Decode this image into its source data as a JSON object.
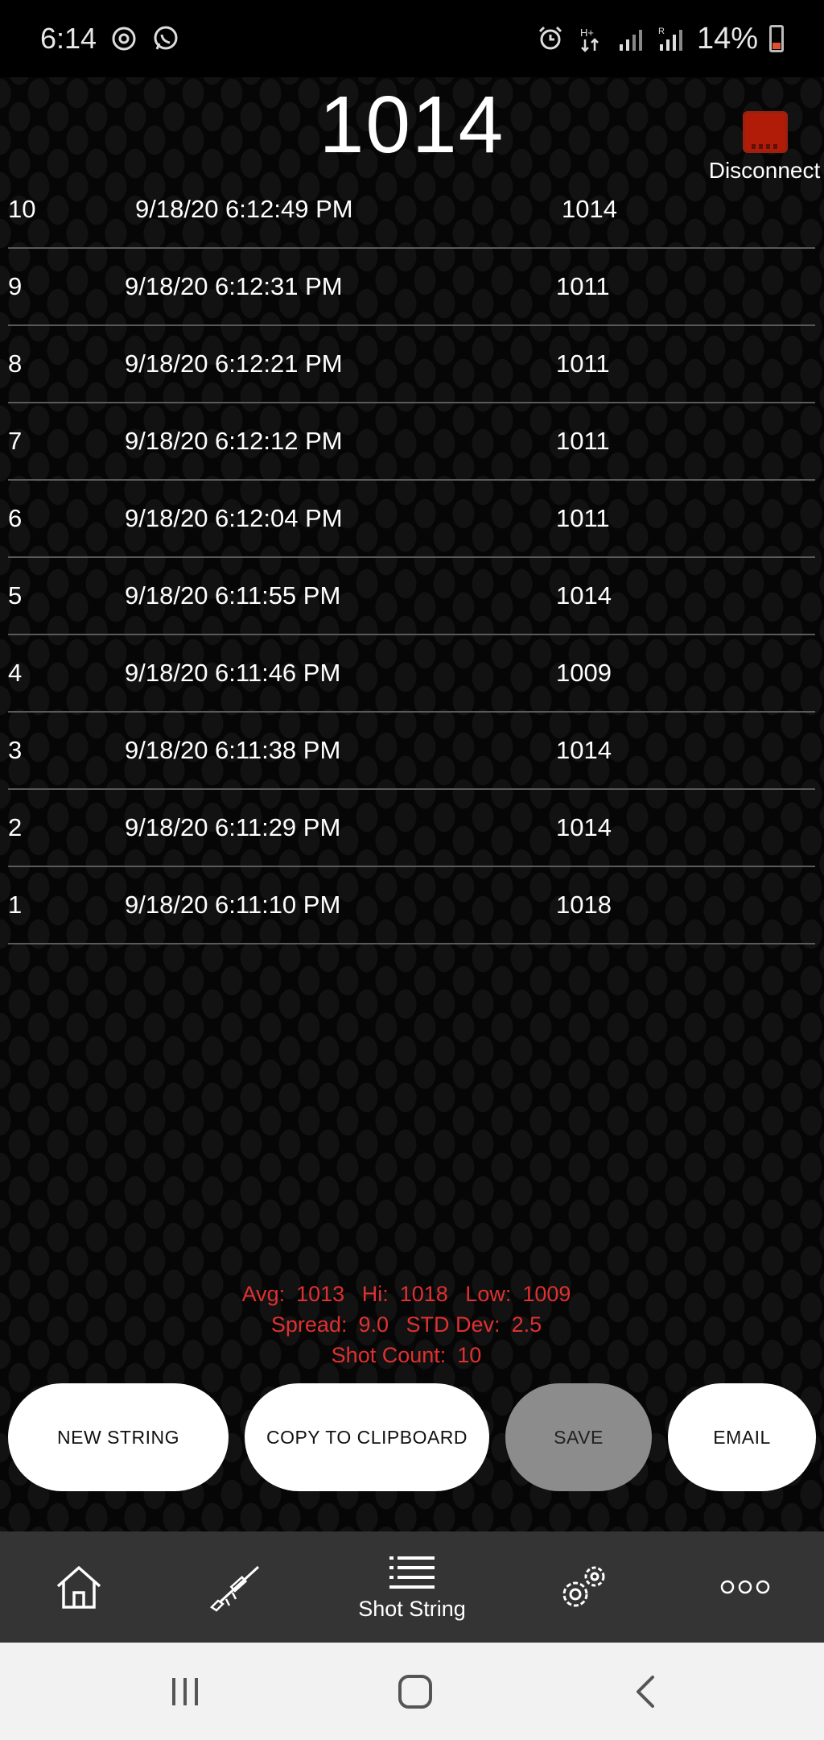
{
  "status_bar": {
    "time": "6:14",
    "battery_percent": "14%"
  },
  "header": {
    "current_reading": "1014",
    "disconnect_label": "Disconnect"
  },
  "shots": [
    {
      "num": "10",
      "time": "9/18/20 6:12:49 PM",
      "velocity": "1014"
    },
    {
      "num": "9",
      "time": "9/18/20 6:12:31 PM",
      "velocity": "1011"
    },
    {
      "num": "8",
      "time": "9/18/20 6:12:21 PM",
      "velocity": "1011"
    },
    {
      "num": "7",
      "time": "9/18/20 6:12:12 PM",
      "velocity": "1011"
    },
    {
      "num": "6",
      "time": "9/18/20 6:12:04 PM",
      "velocity": "1011"
    },
    {
      "num": "5",
      "time": "9/18/20 6:11:55 PM",
      "velocity": "1014"
    },
    {
      "num": "4",
      "time": "9/18/20 6:11:46 PM",
      "velocity": "1009"
    },
    {
      "num": "3",
      "time": "9/18/20 6:11:38 PM",
      "velocity": "1014"
    },
    {
      "num": "2",
      "time": "9/18/20 6:11:29 PM",
      "velocity": "1014"
    },
    {
      "num": "1",
      "time": "9/18/20 6:11:10 PM",
      "velocity": "1018"
    }
  ],
  "stats": {
    "avg_label": "Avg:",
    "avg": "1013",
    "hi_label": "Hi:",
    "hi": "1018",
    "low_label": "Low:",
    "low": "1009",
    "spread_label": "Spread:",
    "spread": "9.0",
    "std_label": "STD Dev:",
    "std": "2.5",
    "count_label": "Shot Count:",
    "count": "10",
    "color": "#e03030"
  },
  "actions": {
    "new_string": "NEW STRING",
    "copy": "COPY TO CLIPBOARD",
    "save": "SAVE",
    "email": "EMAIL"
  },
  "nav": {
    "items": [
      {
        "icon": "home-icon"
      },
      {
        "icon": "rifle-icon"
      },
      {
        "icon": "list-icon",
        "label": "Shot String"
      },
      {
        "icon": "gears-icon"
      },
      {
        "icon": "more-icon"
      }
    ]
  }
}
